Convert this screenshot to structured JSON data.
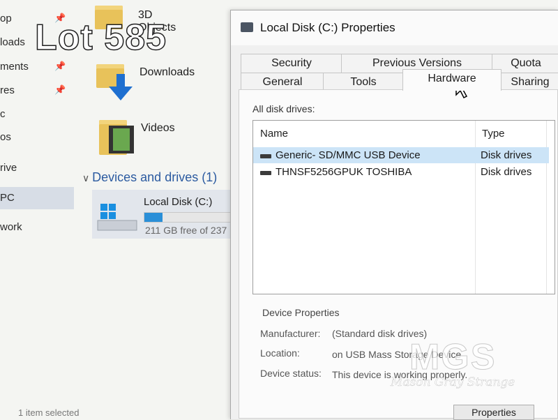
{
  "overlay": {
    "lot_label": "Lot 585"
  },
  "explorer": {
    "nav": [
      {
        "label": "op"
      },
      {
        "label": "loads"
      },
      {
        "label": "ments"
      },
      {
        "label": "res"
      },
      {
        "label": "c"
      },
      {
        "label": "os"
      },
      {
        "label": "rive"
      },
      {
        "label": "PC"
      },
      {
        "label": "work"
      }
    ],
    "folders": [
      {
        "label": "3D Objects"
      },
      {
        "label": "Downloads"
      },
      {
        "label": "Videos"
      }
    ],
    "section_label": "Devices and drives (1)",
    "drive": {
      "name": "Local Disk (C:)",
      "free_text": "211 GB free of 237",
      "used_fraction": 0.2
    },
    "status_text": "1 item selected"
  },
  "dialog": {
    "title": "Local Disk (C:) Properties",
    "tabs_row1": [
      "Security",
      "Previous Versions",
      "Quota"
    ],
    "tabs_row2": [
      "General",
      "Tools",
      "Hardware",
      "Sharing"
    ],
    "active_tab": "Hardware",
    "all_disk_label": "All disk drives:",
    "columns": [
      "Name",
      "Type"
    ],
    "rows": [
      {
        "name": "Generic- SD/MMC USB Device",
        "type": "Disk drives",
        "selected": true
      },
      {
        "name": "THNSF5256GPUK TOSHIBA",
        "type": "Disk drives",
        "selected": false
      }
    ],
    "device_properties": {
      "heading": "Device Properties",
      "manufacturer_label": "Manufacturer:",
      "manufacturer": "(Standard disk drives)",
      "location_label": "Location:",
      "location": "on USB Mass Storage Device",
      "status_label": "Device status:",
      "status": "This device is working properly."
    },
    "properties_button": "Properties"
  },
  "watermark": {
    "brand": "MGS",
    "name": "Mason Gray Strange"
  },
  "colors": {
    "accent": "#2a8fd8",
    "selection": "#cce4f7",
    "section": "#2b5aa0"
  }
}
